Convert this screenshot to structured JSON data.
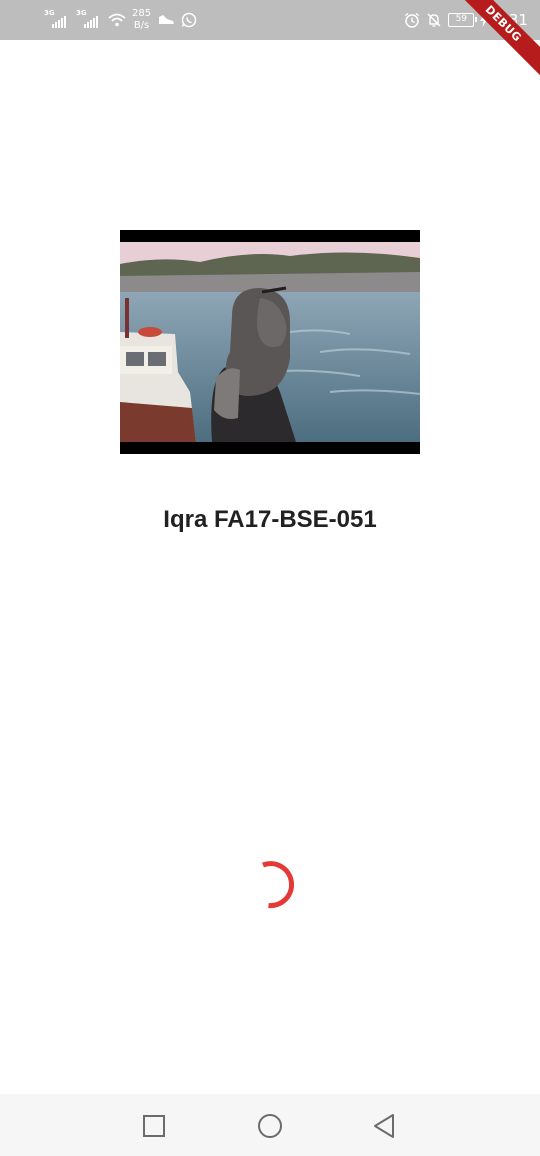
{
  "status_bar": {
    "signal_1_label": "3G",
    "signal_2_label": "3G",
    "net_speed_value": "285",
    "net_speed_unit": "B/s",
    "battery_level": "59",
    "time": "6:31",
    "icons": [
      "signal-icon",
      "signal-icon",
      "wifi-icon",
      "sneaker-icon",
      "whatsapp-icon",
      "alarm-icon",
      "notifications-off-icon",
      "battery-icon",
      "charging-bolt-icon"
    ]
  },
  "debug_banner": {
    "label": "DEBUG",
    "color": "#b71c1c"
  },
  "main": {
    "title": "Iqra FA17-BSE-051",
    "loading_indicator_color": "#e53935"
  },
  "nav_bar": {
    "buttons": [
      "recent-apps-icon",
      "home-icon",
      "back-icon"
    ]
  }
}
